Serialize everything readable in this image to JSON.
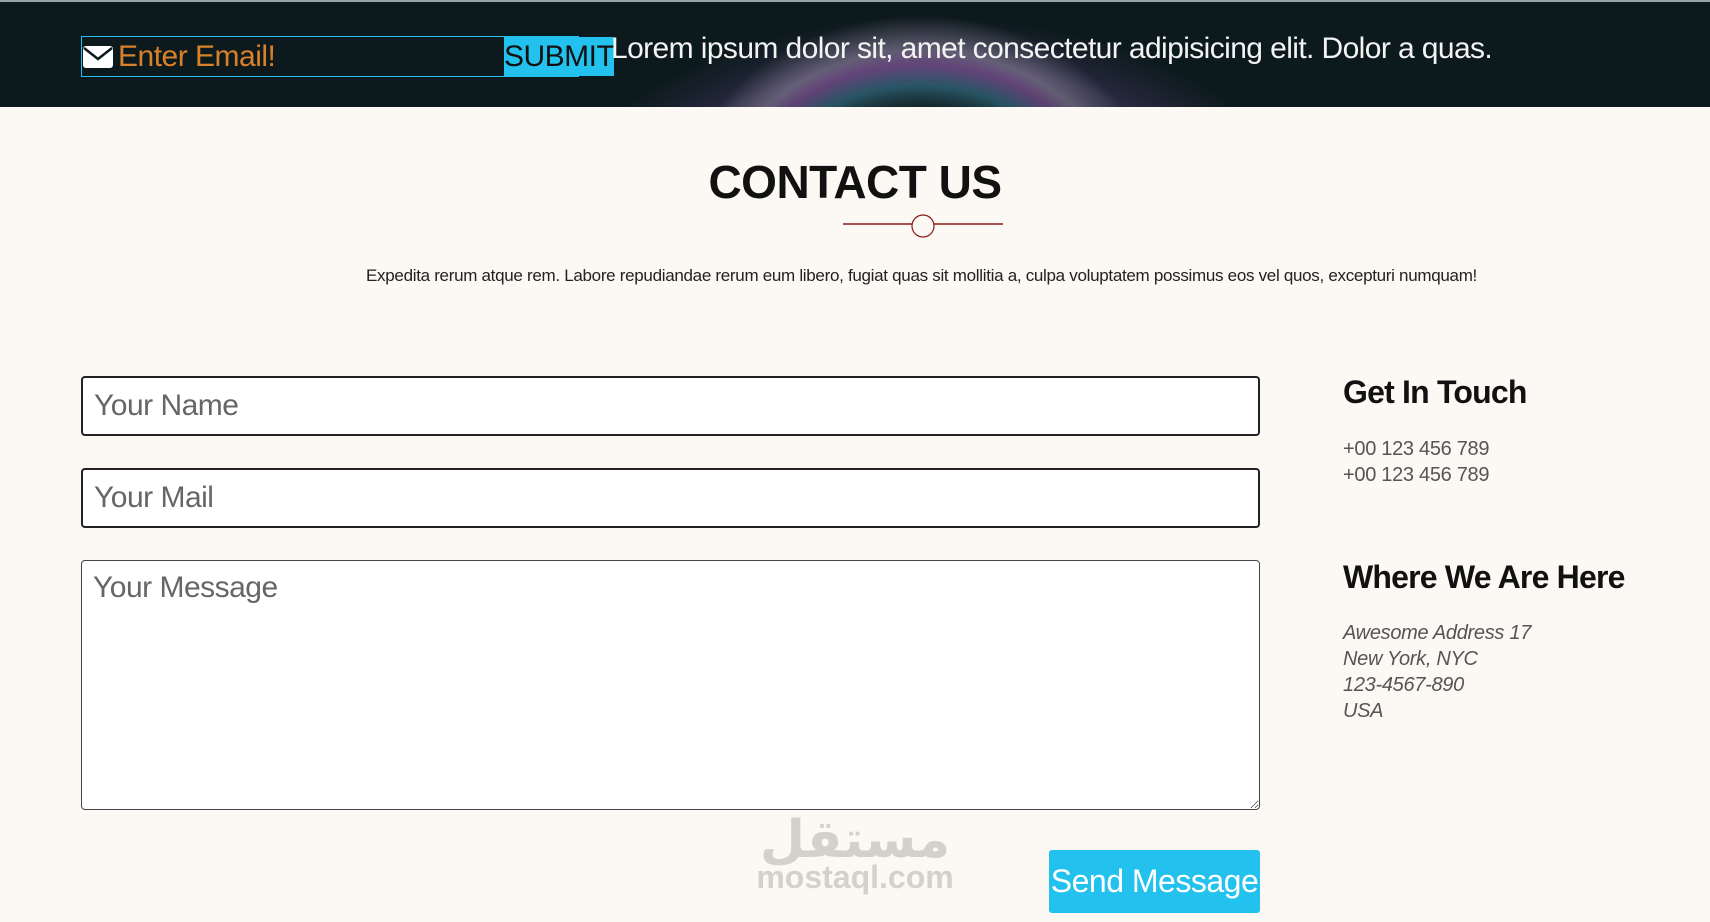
{
  "topbar": {
    "email_placeholder": "Enter Email!",
    "submit_label": "SUBMIT",
    "tagline": "Lorem ipsum dolor sit, amet consectetur adipisicing elit. Dolor a quas.",
    "icon": "envelope-icon"
  },
  "contact": {
    "title": "CONTACT US",
    "intro": "Expedita rerum atque rem. Labore repudiandae rerum eum libero, fugiat quas sit mollitia a, culpa voluptatem possimus eos vel quos, excepturi numquam!"
  },
  "form": {
    "name_placeholder": "Your Name",
    "mail_placeholder": "Your Mail",
    "message_placeholder": "Your Message",
    "send_label": "Send Message"
  },
  "sidebar": {
    "touch_heading": "Get In Touch",
    "phones": [
      "+00 123 456 789",
      "+00 123 456 789"
    ],
    "where_heading": "Where We Are Here",
    "address": [
      "Awesome Address 17",
      "New York, NYC",
      "123-4567-890",
      "USA"
    ]
  },
  "watermark": {
    "arabic": "مستقل",
    "latin": "mostaql.com"
  },
  "colors": {
    "accent": "#22c1ee",
    "email_text": "#d9802a",
    "topbar_bg": "#0d1a1d",
    "divider": "#8b1a1a",
    "page_bg": "#fcf8f4"
  }
}
